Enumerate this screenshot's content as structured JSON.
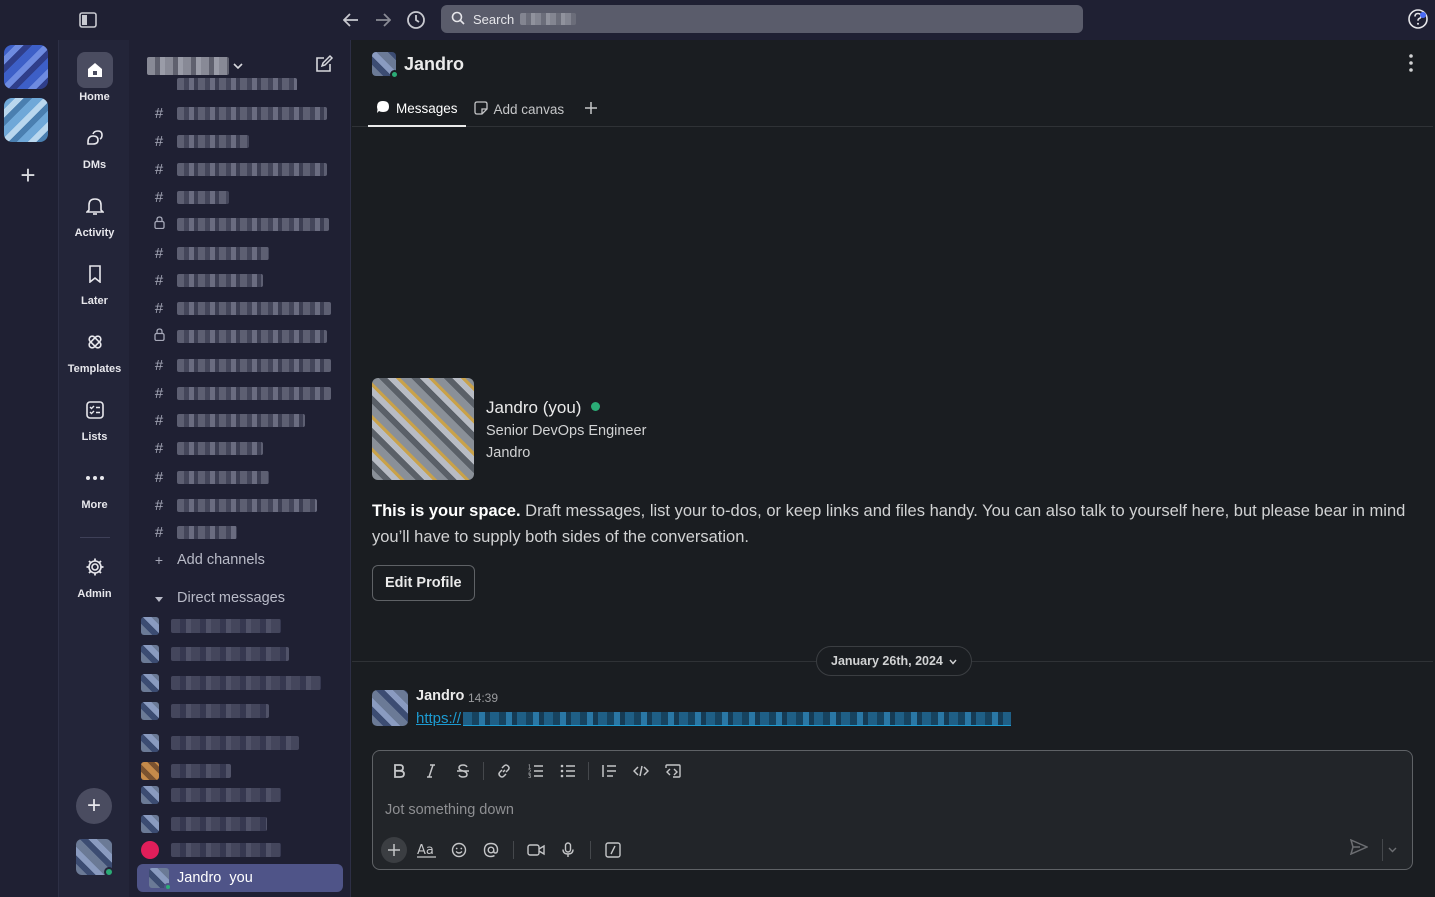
{
  "topbar": {
    "search_label": "Search"
  },
  "rail": {
    "items": [
      {
        "label": "Home"
      },
      {
        "label": "DMs"
      },
      {
        "label": "Activity"
      },
      {
        "label": "Later"
      },
      {
        "label": "Templates"
      },
      {
        "label": "Lists"
      },
      {
        "label": "More"
      },
      {
        "label": "Admin"
      }
    ]
  },
  "sidebar": {
    "add_channels": "Add channels",
    "direct_messages": "Direct messages",
    "self_dm": "Jandro  you"
  },
  "main": {
    "title": "Jandro",
    "tabs": [
      {
        "label": "Messages"
      },
      {
        "label": "Add canvas"
      }
    ],
    "profile": {
      "name": "Jandro (you)",
      "role": "Senior DevOps Engineer",
      "username": "Jandro"
    },
    "intro_bold": "This is your space.",
    "intro_text": " Draft messages, list your to-dos, or keep links and files handy. You can also talk to yourself here, but please bear in mind you’ll have to supply both sides of the conversation.",
    "edit_profile": "Edit Profile",
    "date_divider": "January 26th, 2024",
    "message": {
      "author": "Jandro",
      "time": "14:39",
      "link_prefix": "https://"
    },
    "composer": {
      "placeholder": "Jot something down"
    }
  },
  "colors": {
    "accent": "#4f5488",
    "online": "#2bac76",
    "link": "#1d9bd1"
  }
}
